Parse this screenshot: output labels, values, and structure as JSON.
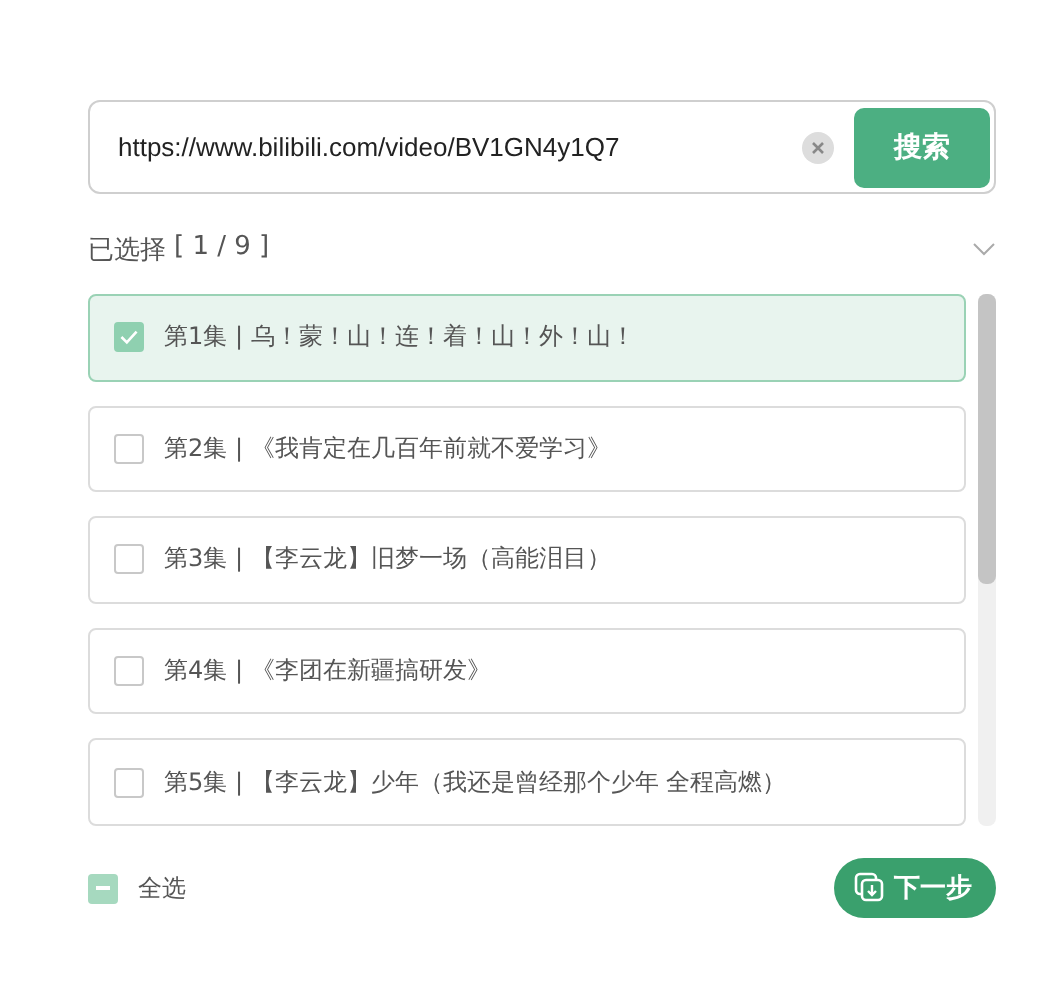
{
  "search": {
    "value": "https://www.bilibili.com/video/BV1GN4y1Q7",
    "button": "搜索"
  },
  "selection": {
    "label": "已选择",
    "count": "[ 1 / 9 ]",
    "expanded": true
  },
  "episodes": [
    {
      "label": "第1集 | 乌！蒙！山！连！着！山！外！山！",
      "selected": true
    },
    {
      "label": "第2集 | 《我肯定在几百年前就不爱学习》",
      "selected": false
    },
    {
      "label": "第3集 | 【李云龙】旧梦一场（高能泪目）",
      "selected": false
    },
    {
      "label": "第4集 | 《李团在新疆搞研发》",
      "selected": false
    },
    {
      "label": "第5集 | 【李云龙】少年（我还是曾经那个少年 全程高燃）",
      "selected": false
    }
  ],
  "select_all": {
    "label": "全选",
    "indeterminate": true
  },
  "next_button": "下一步"
}
